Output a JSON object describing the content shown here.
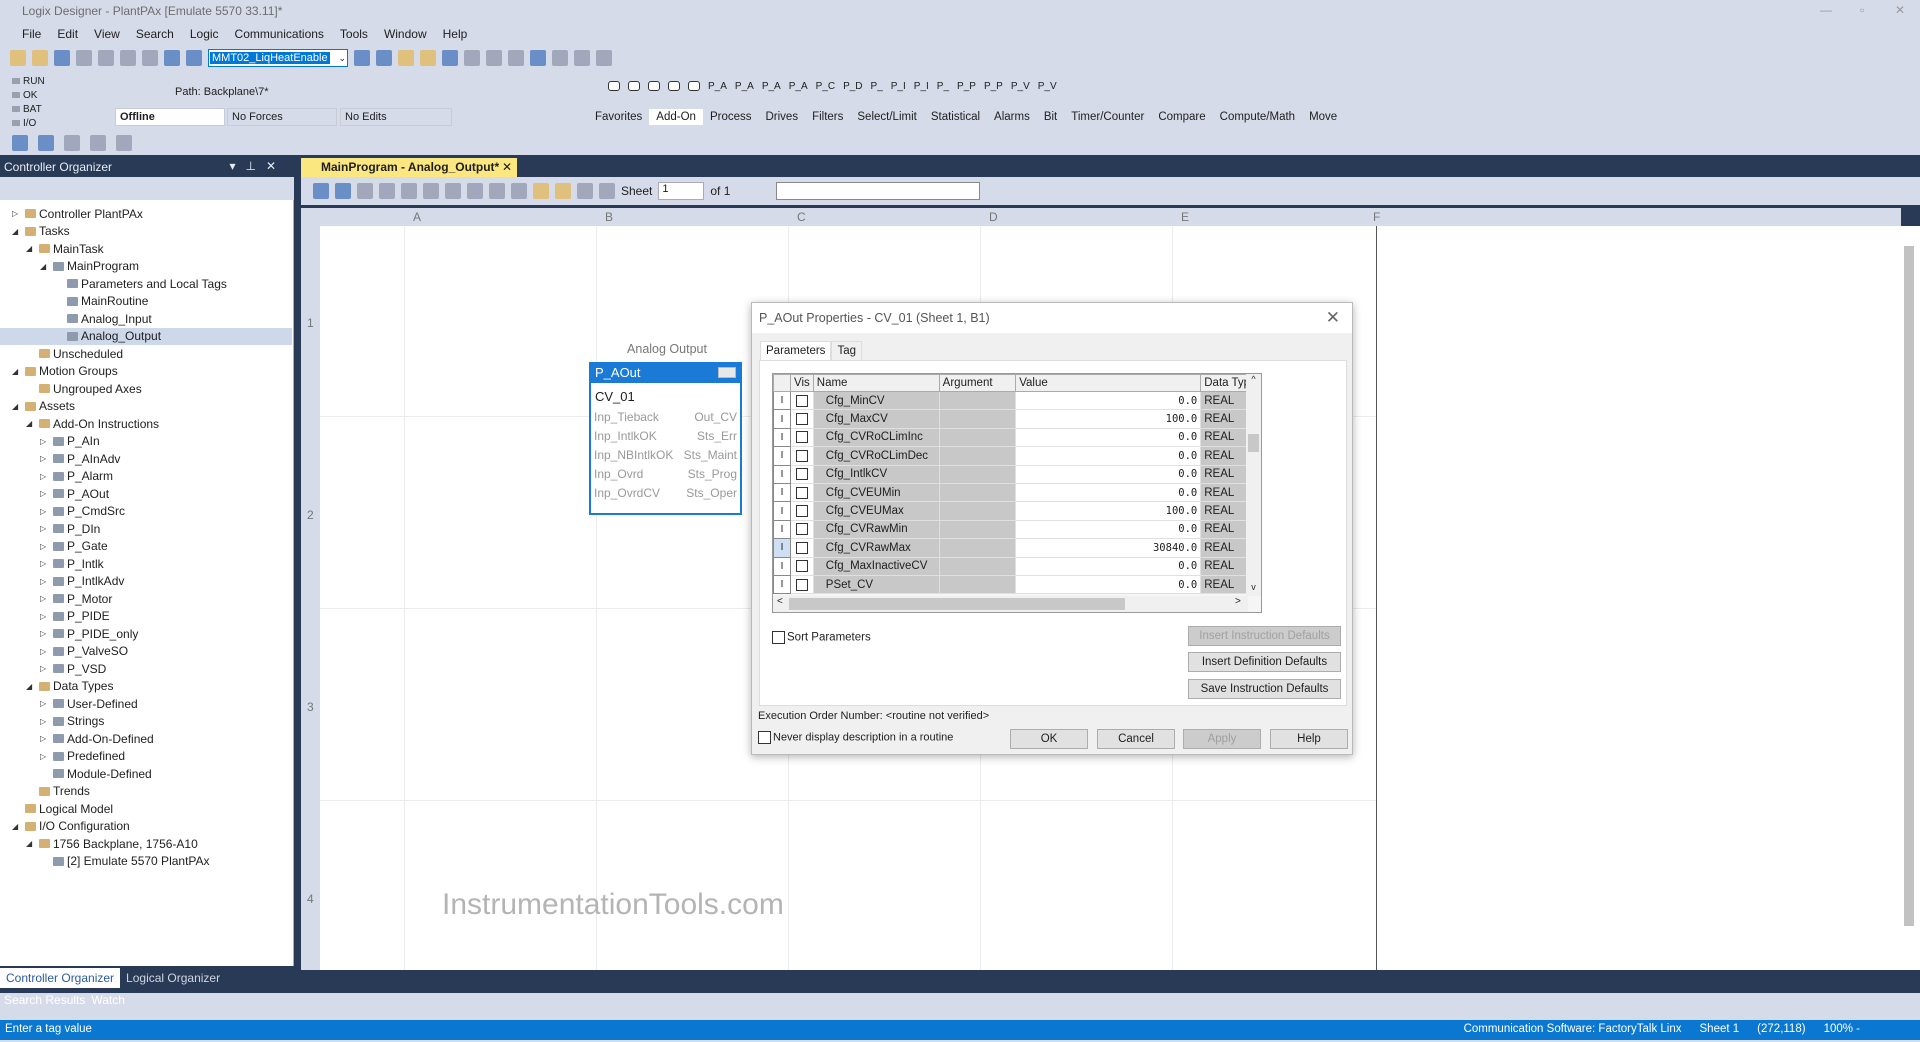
{
  "window": {
    "title": "Logix Designer - PlantPAx [Emulate 5570 33.11]*"
  },
  "menu": [
    "File",
    "Edit",
    "View",
    "Search",
    "Logic",
    "Communications",
    "Tools",
    "Window",
    "Help"
  ],
  "toolbar": {
    "routine_select": "MMT02_LiqHeatEnable"
  },
  "controller_status": {
    "leds": [
      "RUN",
      "OK",
      "BAT",
      "I/O"
    ],
    "path": "Path: Backplane\\7*",
    "mode": "Offline",
    "forces": "No Forces",
    "edits": "No Edits"
  },
  "palette": {
    "instructions": [
      "P_A",
      "P_A",
      "P_A",
      "P_A",
      "P_C",
      "P_D",
      "P_",
      "P_I",
      "P_I",
      "P_",
      "P_P",
      "P_P",
      "P_V",
      "P_V"
    ],
    "tabs": [
      "Favorites",
      "Add-On",
      "Process",
      "Drives",
      "Filters",
      "Select/Limit",
      "Statistical",
      "Alarms",
      "Bit",
      "Timer/Counter",
      "Compare",
      "Compute/Math",
      "Move"
    ],
    "active_tab": "Add-On"
  },
  "organizer": {
    "title": "Controller Organizer",
    "tabs": [
      "Controller Organizer",
      "Logical Organizer"
    ],
    "tree": [
      {
        "label": "Controller PlantPAx",
        "level": 0,
        "exp": "closed"
      },
      {
        "label": "Tasks",
        "level": 0,
        "exp": "open"
      },
      {
        "label": "MainTask",
        "level": 1,
        "exp": "open"
      },
      {
        "label": "MainProgram",
        "level": 2,
        "exp": "open"
      },
      {
        "label": "Parameters and Local Tags",
        "level": 3
      },
      {
        "label": "MainRoutine",
        "level": 3
      },
      {
        "label": "Analog_Input",
        "level": 3
      },
      {
        "label": "Analog_Output",
        "level": 3,
        "selected": true
      },
      {
        "label": "Unscheduled",
        "level": 1
      },
      {
        "label": "Motion Groups",
        "level": 0,
        "exp": "open"
      },
      {
        "label": "Ungrouped Axes",
        "level": 1
      },
      {
        "label": "Assets",
        "level": 0,
        "exp": "open"
      },
      {
        "label": "Add-On Instructions",
        "level": 1,
        "exp": "open"
      },
      {
        "label": "P_AIn",
        "level": 2,
        "exp": "closed"
      },
      {
        "label": "P_AInAdv",
        "level": 2,
        "exp": "closed"
      },
      {
        "label": "P_Alarm",
        "level": 2,
        "exp": "closed"
      },
      {
        "label": "P_AOut",
        "level": 2,
        "exp": "closed"
      },
      {
        "label": "P_CmdSrc",
        "level": 2,
        "exp": "closed"
      },
      {
        "label": "P_DIn",
        "level": 2,
        "exp": "closed"
      },
      {
        "label": "P_Gate",
        "level": 2,
        "exp": "closed"
      },
      {
        "label": "P_Intlk",
        "level": 2,
        "exp": "closed"
      },
      {
        "label": "P_IntlkAdv",
        "level": 2,
        "exp": "closed"
      },
      {
        "label": "P_Motor",
        "level": 2,
        "exp": "closed"
      },
      {
        "label": "P_PIDE",
        "level": 2,
        "exp": "closed"
      },
      {
        "label": "P_PIDE_only",
        "level": 2,
        "exp": "closed"
      },
      {
        "label": "P_ValveSO",
        "level": 2,
        "exp": "closed"
      },
      {
        "label": "P_VSD",
        "level": 2,
        "exp": "closed"
      },
      {
        "label": "Data Types",
        "level": 1,
        "exp": "open"
      },
      {
        "label": "User-Defined",
        "level": 2,
        "exp": "closed"
      },
      {
        "label": "Strings",
        "level": 2,
        "exp": "closed"
      },
      {
        "label": "Add-On-Defined",
        "level": 2,
        "exp": "closed"
      },
      {
        "label": "Predefined",
        "level": 2,
        "exp": "closed"
      },
      {
        "label": "Module-Defined",
        "level": 2
      },
      {
        "label": "Trends",
        "level": 1
      },
      {
        "label": "Logical Model",
        "level": 0
      },
      {
        "label": "I/O Configuration",
        "level": 0,
        "exp": "open"
      },
      {
        "label": "1756 Backplane, 1756-A10",
        "level": 1,
        "exp": "open"
      },
      {
        "label": "[2] Emulate 5570 PlantPAx",
        "level": 2
      }
    ]
  },
  "bottom_tabs": [
    "Search Results",
    "Watch"
  ],
  "statusbar": {
    "message": "Enter a tag value",
    "comm": "Communication Software: FactoryTalk Linx",
    "sheet": "Sheet 1",
    "coords": "(272,118)",
    "zoom": "100% -"
  },
  "editor": {
    "tab": "MainProgram - Analog_Output*",
    "sheet_label": "Sheet",
    "sheet_value": "1",
    "sheet_of": "of 1",
    "columns": [
      "A",
      "B",
      "C",
      "D",
      "E",
      "F"
    ],
    "rows": [
      "1",
      "2",
      "3",
      "4"
    ]
  },
  "watermark": "InstrumentationTools.com",
  "block": {
    "caption": "Analog Output",
    "type": "P_AOut",
    "tag": "CV_01",
    "inputs": [
      "Inp_Tieback",
      "Inp_IntlkOK",
      "Inp_NBIntlkOK",
      "Inp_Ovrd",
      "Inp_OvrdCV"
    ],
    "outputs": [
      "Out_CV",
      "Sts_Err",
      "Sts_Maint",
      "Sts_Prog",
      "Sts_Oper"
    ]
  },
  "dialog": {
    "title": "P_AOut Properties - CV_01 (Sheet 1, B1)",
    "tabs": [
      "Parameters",
      "Tag"
    ],
    "headers": [
      "",
      "Vis",
      "Name",
      "Argument",
      "Value",
      "Data Type"
    ],
    "rows": [
      {
        "ind": "I",
        "name": "Cfg_MinCV",
        "value": "0.0",
        "type": "REAL"
      },
      {
        "ind": "I",
        "name": "Cfg_MaxCV",
        "value": "100.0",
        "type": "REAL"
      },
      {
        "ind": "I",
        "name": "Cfg_CVRoCLimInc",
        "value": "0.0",
        "type": "REAL"
      },
      {
        "ind": "I",
        "name": "Cfg_CVRoCLimDec",
        "value": "0.0",
        "type": "REAL"
      },
      {
        "ind": "I",
        "name": "Cfg_IntlkCV",
        "value": "0.0",
        "type": "REAL"
      },
      {
        "ind": "I",
        "name": "Cfg_CVEUMin",
        "value": "0.0",
        "type": "REAL"
      },
      {
        "ind": "I",
        "name": "Cfg_CVEUMax",
        "value": "100.0",
        "type": "REAL"
      },
      {
        "ind": "I",
        "name": "Cfg_CVRawMin",
        "value": "0.0",
        "type": "REAL"
      },
      {
        "ind": "I",
        "name": "Cfg_CVRawMax",
        "value": "30840.0",
        "type": "REAL",
        "current": true
      },
      {
        "ind": "I",
        "name": "Cfg_MaxInactiveCV",
        "value": "0.0",
        "type": "REAL"
      },
      {
        "ind": "I",
        "name": "PSet_CV",
        "value": "0.0",
        "type": "REAL"
      }
    ],
    "sort_label": "Sort Parameters",
    "insert_instr": "Insert Instruction Defaults",
    "insert_def": "Insert Definition Defaults",
    "save_instr": "Save Instruction Defaults",
    "exec_label": "Execution Order Number:",
    "exec_value": "<routine not verified>",
    "never_display": "Never display description in a routine",
    "ok": "OK",
    "cancel": "Cancel",
    "apply": "Apply",
    "help": "Help"
  }
}
